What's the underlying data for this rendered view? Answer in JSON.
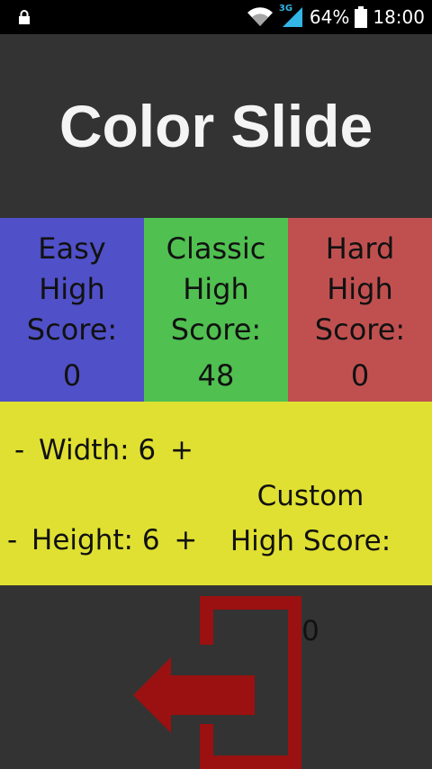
{
  "status": {
    "battery": "64%",
    "time": "18:00",
    "network": "3G"
  },
  "title": "Color Slide",
  "modes": [
    {
      "label": "Easy\nHigh\nScore:",
      "score": "0",
      "color": "#5050c8"
    },
    {
      "label": "Classic\nHigh\nScore:",
      "score": "48",
      "color": "#50c050"
    },
    {
      "label": "Hard\nHigh\nScore:",
      "score": "0",
      "color": "#c05050"
    }
  ],
  "custom": {
    "width_label": "Width: 6",
    "height_label": "Height: 6",
    "minus": "-",
    "plus": "+",
    "score_label": "Custom\nHigh Score:",
    "score": "0",
    "color": "#e0e032"
  },
  "exit": {
    "icon": "exit-icon",
    "color": "#9b1010"
  }
}
